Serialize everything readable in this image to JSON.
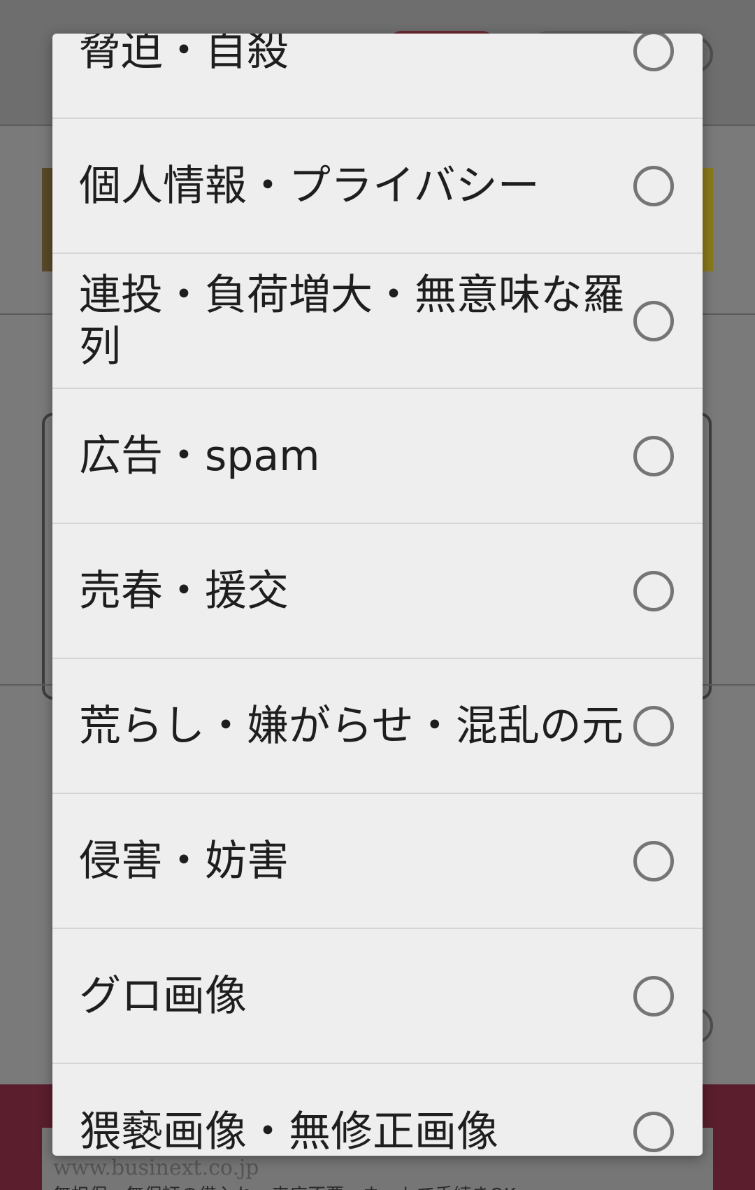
{
  "background": {
    "url_text": "www.businext.co.jp",
    "url_subtext": "無担保・無保証の借入れ、来店不要。ネットで手続きOK"
  },
  "dialog": {
    "options": [
      {
        "label": "脅迫・自殺",
        "selected": false
      },
      {
        "label": "個人情報・プライバシー",
        "selected": false
      },
      {
        "label": "連投・負荷増大・無意味な羅列",
        "selected": false
      },
      {
        "label": "広告・spam",
        "selected": false
      },
      {
        "label": "売春・援交",
        "selected": false
      },
      {
        "label": "荒らし・嫌がらせ・混乱の元",
        "selected": false
      },
      {
        "label": "侵害・妨害",
        "selected": false
      },
      {
        "label": "グロ画像",
        "selected": false
      },
      {
        "label": "猥褻画像・無修正画像",
        "selected": false
      }
    ]
  },
  "colors": {
    "dialog_bg": "#eeeeee",
    "divider": "#d5d5d5",
    "radio_border": "#757575",
    "text": "#1e1e1e",
    "scrim": "#6a6a6a"
  }
}
